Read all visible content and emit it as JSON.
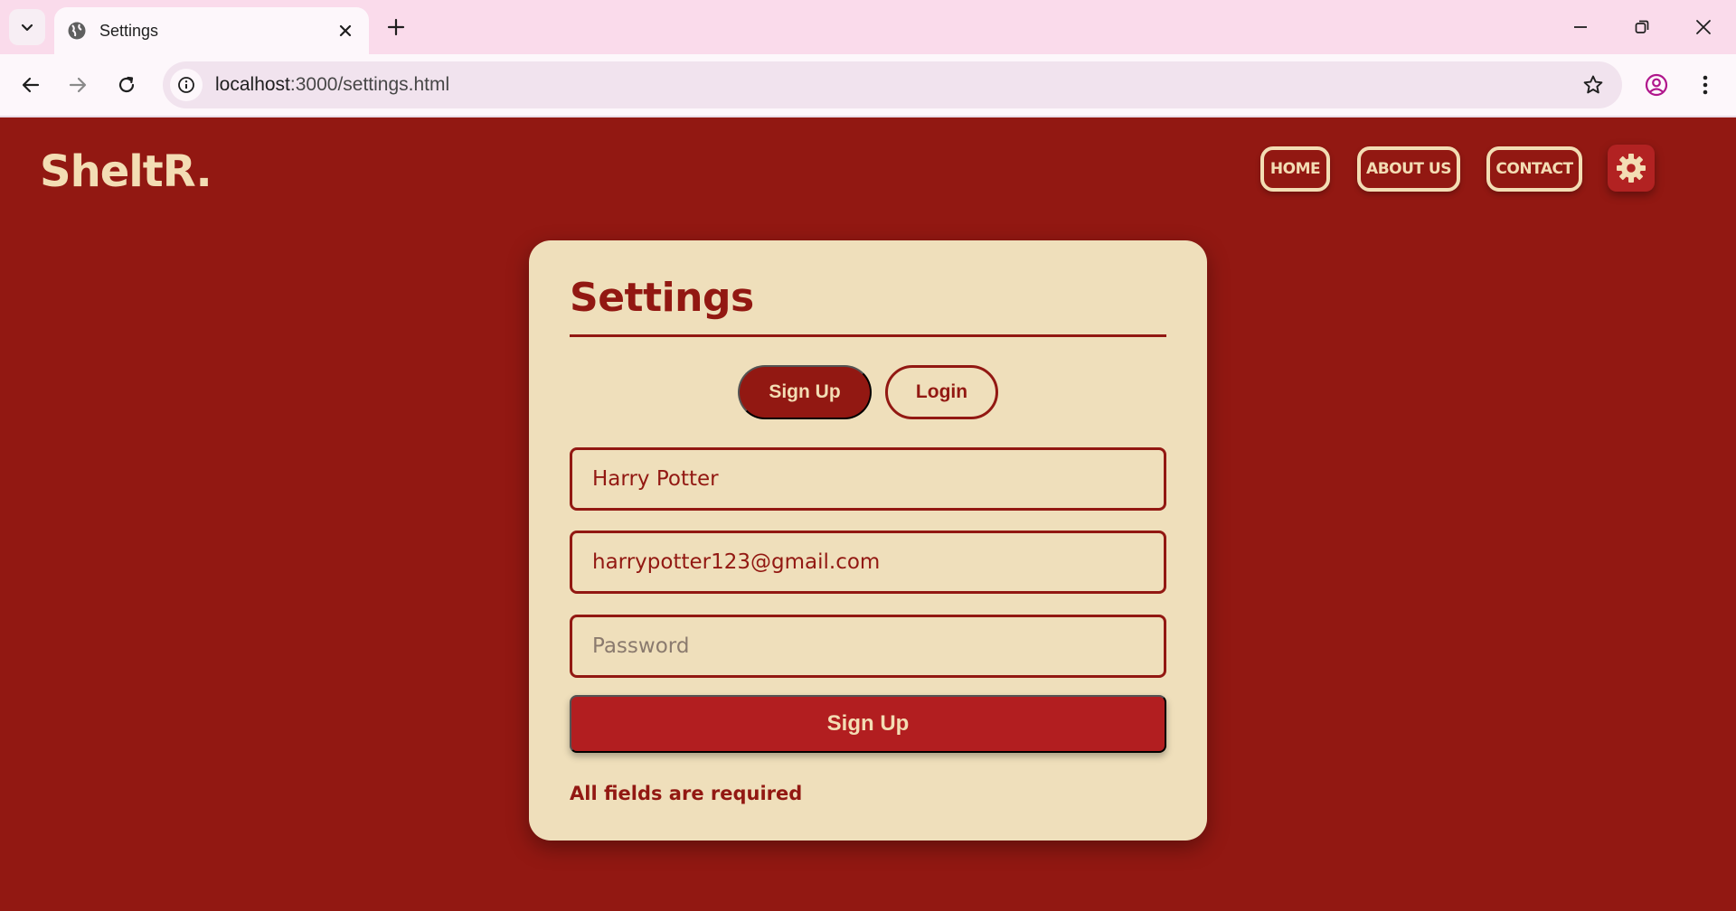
{
  "browser": {
    "tab": {
      "title": "Settings"
    },
    "address": {
      "host": "localhost",
      "path": ":3000/settings.html"
    }
  },
  "site": {
    "logo": "SheltR.",
    "nav": {
      "home": "HOME",
      "about": "ABOUT US",
      "contact": "CONTACT"
    }
  },
  "settings": {
    "title": "Settings",
    "tabs": {
      "signup": "Sign Up",
      "login": "Login"
    },
    "fields": {
      "name": {
        "value": "Harry Potter"
      },
      "email": {
        "value": "harrypotter123@gmail.com"
      },
      "password": {
        "placeholder": "Password"
      }
    },
    "submit_label": "Sign Up",
    "message": "All fields are required"
  },
  "colors": {
    "page_bg": "#921812",
    "cream": "#f3ddb4",
    "card_bg": "#efdfbb",
    "accent_red": "#b21e20",
    "tabbar_bg": "#fadbeb"
  }
}
